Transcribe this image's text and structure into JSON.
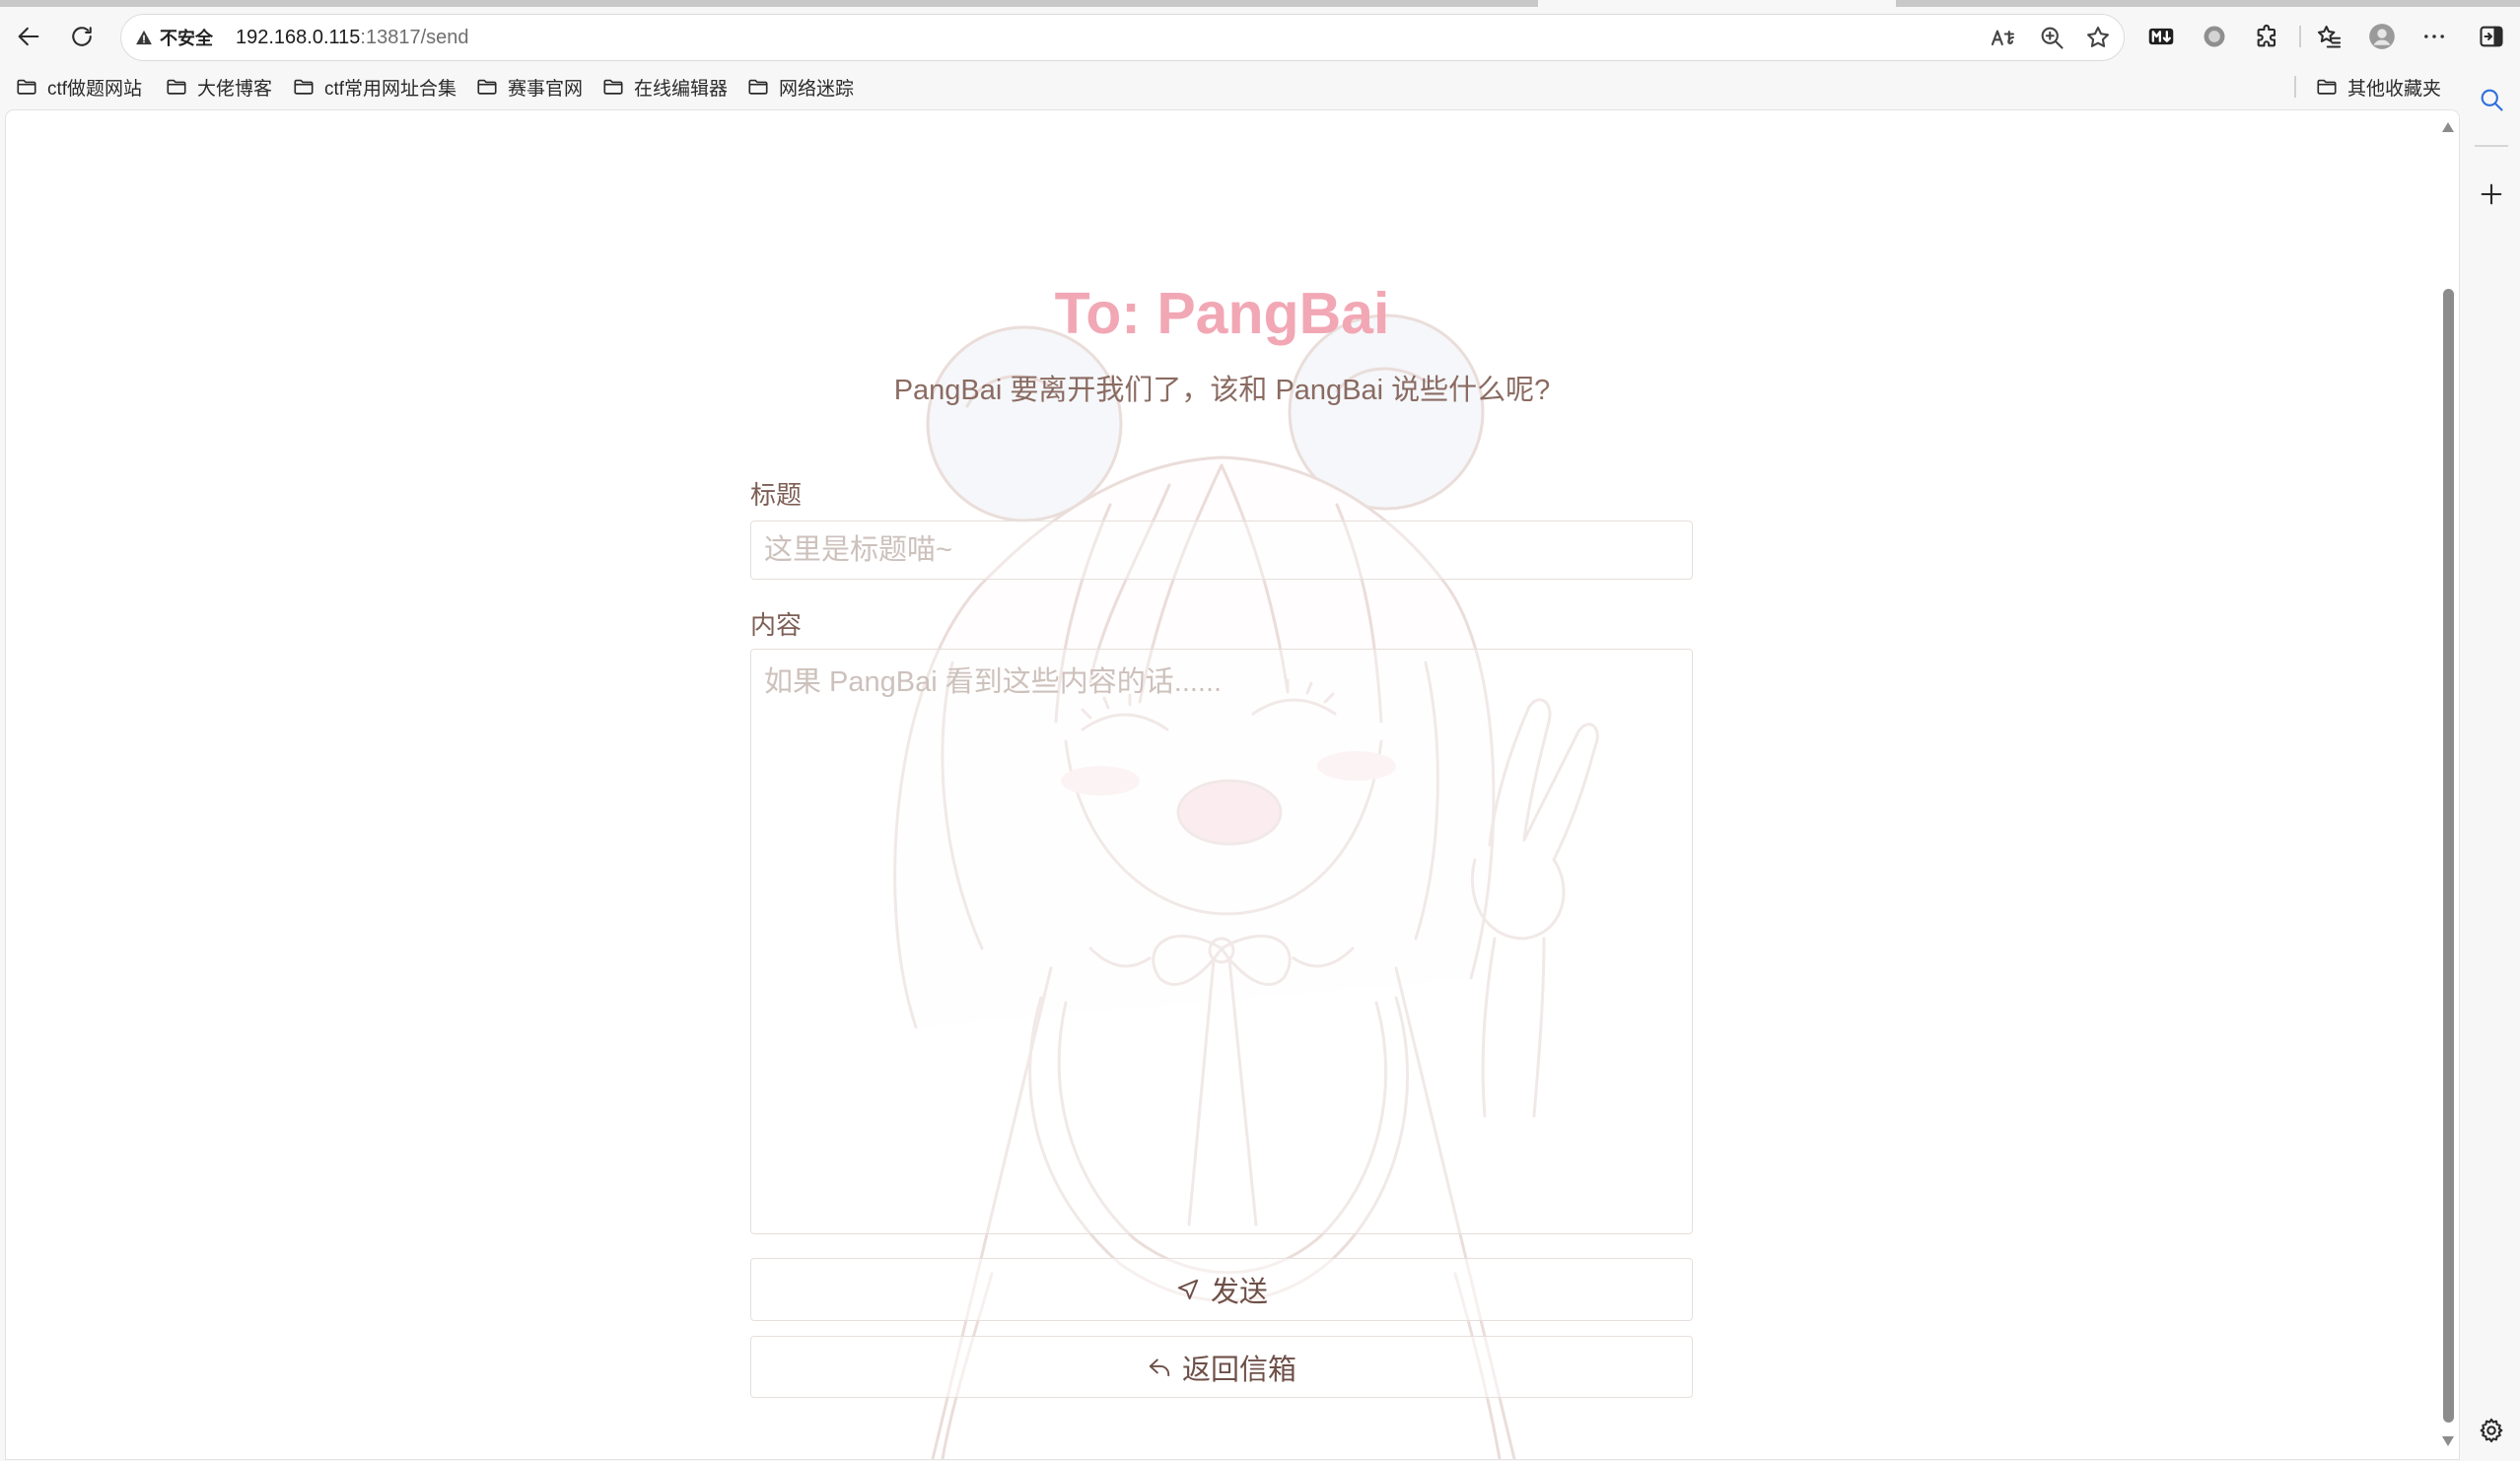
{
  "browser": {
    "address_bar": {
      "security_label": "不安全",
      "url_host": "192.168.0.115",
      "url_path": ":13817/send"
    },
    "icons": {
      "back": "back-arrow-icon",
      "reload": "reload-icon",
      "security": "warning-icon",
      "read_aloud": "read-aloud-icon",
      "zoom": "zoom-icon",
      "favorite": "star-icon",
      "markdown_extension": "markdown-extension-icon",
      "circle_extension": "circle-extension-icon",
      "extensions": "puzzle-icon",
      "favorites": "favorites-icon",
      "profile": "profile-avatar-icon",
      "more": "more-icon",
      "sidebar_toggle": "sidebar-toggle-icon"
    }
  },
  "bookmarks": {
    "items": [
      {
        "label": "ctf做题网站",
        "icon": "folder-icon"
      },
      {
        "label": "大佬博客",
        "icon": "folder-icon"
      },
      {
        "label": "ctf常用网址合集",
        "icon": "folder-icon"
      },
      {
        "label": "赛事官网",
        "icon": "folder-icon"
      },
      {
        "label": "在线编辑器",
        "icon": "folder-icon"
      },
      {
        "label": "网络迷踪",
        "icon": "folder-icon"
      }
    ],
    "other": {
      "label": "其他收藏夹",
      "icon": "folder-icon"
    }
  },
  "sidebar": {
    "icons": [
      "search-icon",
      "add-icon",
      "settings-gear-icon"
    ]
  },
  "page": {
    "title": "To: PangBai",
    "subtitle": "PangBai 要离开我们了，该和 PangBai 说些什么呢?",
    "form": {
      "title_field": {
        "label": "标题",
        "placeholder": "这里是标题喵~",
        "value": ""
      },
      "content_field": {
        "label": "内容",
        "placeholder": "如果 PangBai 看到这些内容的话......",
        "value": ""
      },
      "send_button": {
        "label": "发送",
        "icon": "send-icon"
      },
      "back_button": {
        "label": "返回信箱",
        "icon": "reply-icon"
      }
    }
  },
  "colors": {
    "title_pink": "#f2a7b5",
    "text_brown": "#7d5f56",
    "placeholder": "#cdc1bc",
    "field_border": "#e6dfdb",
    "chrome_bg": "#f7f7f7"
  }
}
